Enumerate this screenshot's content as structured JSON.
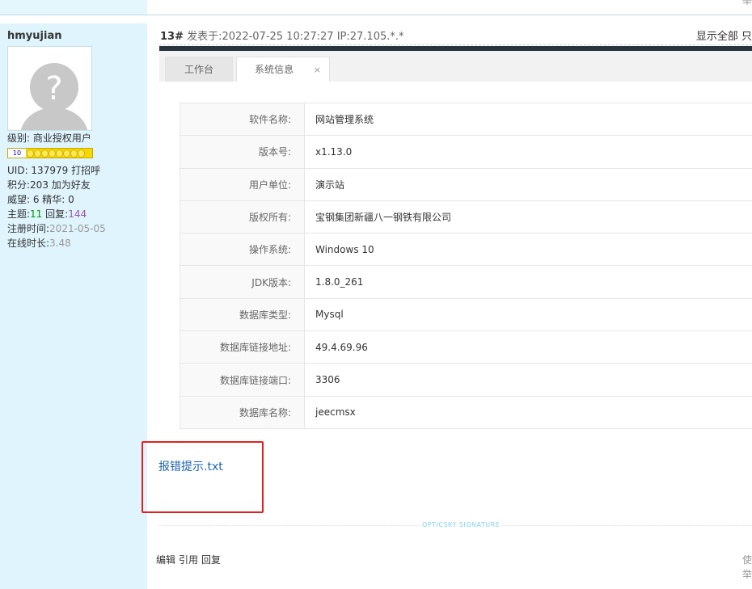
{
  "top_right": "举",
  "user": {
    "name": "hmyujian",
    "level_label": "级别: 商业授权用户",
    "level_badge": "10",
    "uid_label": "UID: 137979",
    "greet": "打招呼",
    "points_label": "积分:203",
    "add_friend": "加为好友",
    "prestige": "威望: 6 精华: 0",
    "topics_label": "主题:",
    "topics": "11",
    "replies_label": "回复:",
    "replies": "144",
    "reg_label": "注册时间:",
    "reg": "2021-05-05",
    "online_label": "在线时长:",
    "online": "3.48"
  },
  "post": {
    "floor": "13#",
    "meta": "发表于:2022-07-25 10:27:27  IP:27.105.*.*",
    "right": "显示全部 只"
  },
  "tabs": [
    {
      "label": "工作台"
    },
    {
      "label": "系统信息",
      "close": "×"
    }
  ],
  "rows": [
    {
      "k": "软件名称:",
      "v": "网站管理系统"
    },
    {
      "k": "版本号:",
      "v": "x1.13.0"
    },
    {
      "k": "用户单位:",
      "v": "演示站"
    },
    {
      "k": "版权所有:",
      "v": "宝钢集团新疆八一钢铁有限公司"
    },
    {
      "k": "操作系统:",
      "v": "Windows 10"
    },
    {
      "k": "JDK版本:",
      "v": "1.8.0_261"
    },
    {
      "k": "数据库类型:",
      "v": "Mysql"
    },
    {
      "k": "数据库链接地址:",
      "v": "49.4.69.96"
    },
    {
      "k": "数据库链接端口:",
      "v": "3306"
    },
    {
      "k": "数据库名称:",
      "v": "jeecmsx"
    }
  ],
  "attachment": "报错提示.txt",
  "signature": "OPTICSKY SIGNATURE",
  "actions": [
    "编辑",
    "引用",
    "回复"
  ],
  "right_actions": [
    "使",
    "举"
  ]
}
